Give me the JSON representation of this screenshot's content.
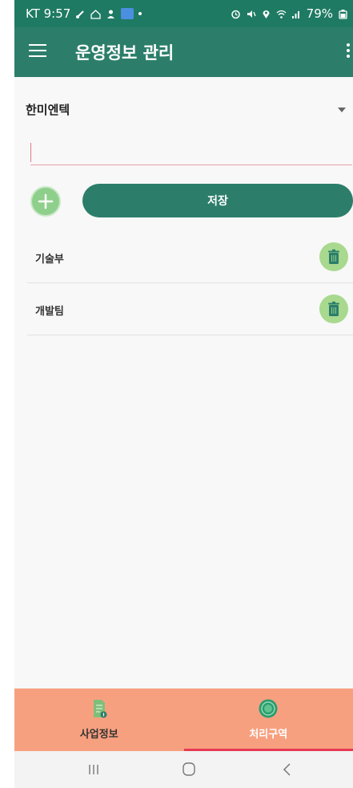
{
  "status_bar": {
    "carrier_time": "KT 9:57",
    "battery": "79%"
  },
  "app_bar": {
    "title": "운영정보 관리",
    "menu_icon": "hamburger-menu-icon",
    "overflow_icon": "overflow-menu-icon"
  },
  "dropdown": {
    "selected": "한미엔텍"
  },
  "input": {
    "value": "",
    "placeholder": ""
  },
  "actions": {
    "save_label": "저장",
    "add_icon": "plus-icon"
  },
  "list": {
    "items": [
      {
        "label": "기술부"
      },
      {
        "label": "개발팀"
      }
    ],
    "delete_icon": "trash-icon"
  },
  "bottom_nav": {
    "tabs": [
      {
        "label": "사업정보",
        "icon": "document-icon"
      },
      {
        "label": "처리구역",
        "icon": "target-circle-icon"
      }
    ],
    "active_index": 1
  },
  "colors": {
    "primary": "#2c7e6a",
    "status_bar": "#1f7a63",
    "accent_green": "#8fcf8c",
    "bottom_nav_bg": "#f7a07f",
    "active_underline": "#e63a52"
  }
}
